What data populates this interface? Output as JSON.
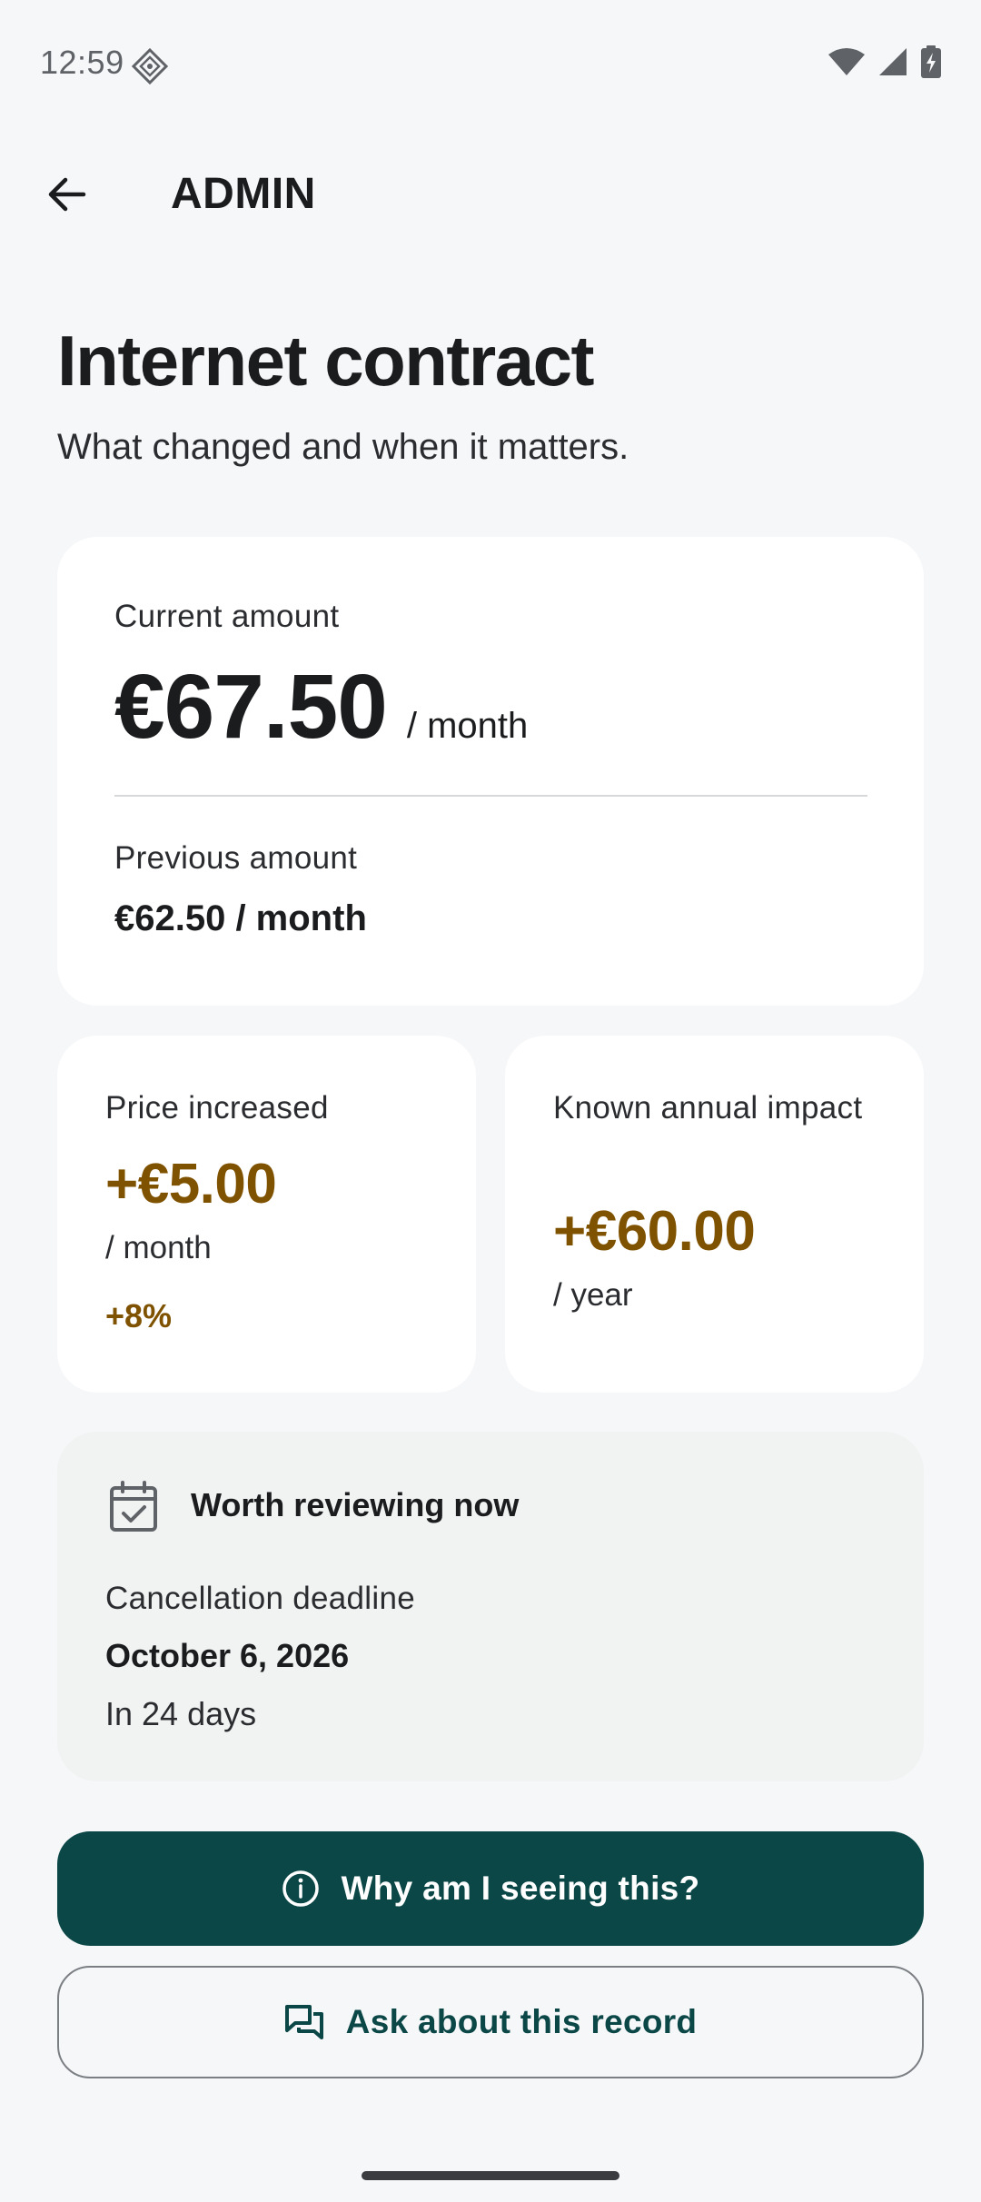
{
  "status_bar": {
    "time": "12:59"
  },
  "app_bar": {
    "title": "ADMIN"
  },
  "page": {
    "title": "Internet contract",
    "subtitle": "What changed and when it matters."
  },
  "amount_card": {
    "current_label": "Current amount",
    "current_value": "€67.50",
    "current_unit": "/ month",
    "previous_label": "Previous amount",
    "previous_value": "€62.50 / month"
  },
  "price_card": {
    "label": "Price increased",
    "value": "+€5.00",
    "unit": "/ month",
    "percent": "+8%"
  },
  "impact_card": {
    "label": "Known annual impact",
    "value": "+€60.00",
    "unit": "/ year"
  },
  "review_card": {
    "title": "Worth reviewing now",
    "deadline_label": "Cancellation deadline",
    "deadline_date": "October 6, 2026",
    "deadline_relative": "In 24 days"
  },
  "actions": {
    "primary_label": "Why am I seeing this?",
    "secondary_label": "Ask about this record"
  },
  "colors": {
    "accent": "#0b4746",
    "increase": "#7f5200",
    "background": "#f6f7f9",
    "card": "#ffffff",
    "review_card": "#f1f2f2"
  },
  "icons": {
    "back": "arrow-back-icon",
    "calendar": "calendar-check-icon",
    "info": "info-icon",
    "chat": "chat-icon"
  }
}
